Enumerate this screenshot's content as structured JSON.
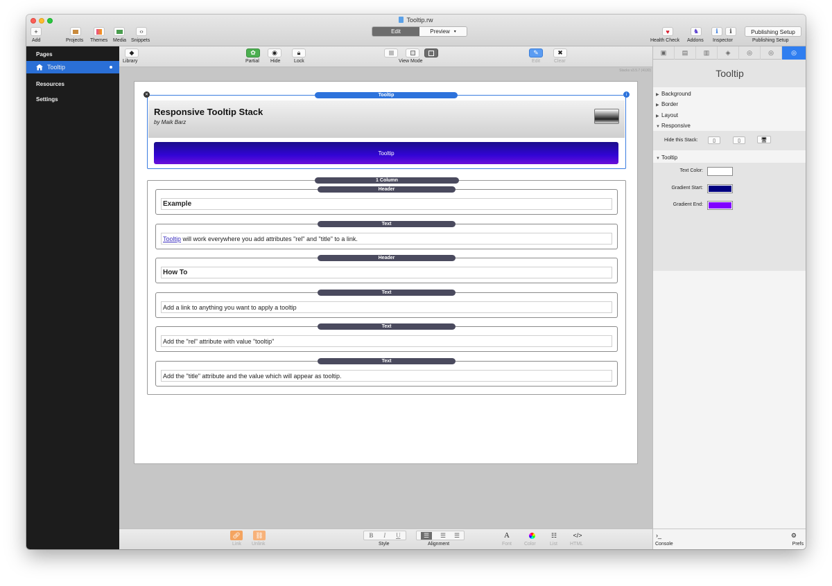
{
  "window": {
    "title": "Tooltip.rw"
  },
  "toolbar": {
    "add": "Add",
    "projects": "Projects",
    "themes": "Themes",
    "media": "Media",
    "snippets": "Snippets",
    "edit": "Edit",
    "preview": "Preview",
    "health_check": "Health Check",
    "addons": "Addons",
    "inspector": "Inspector",
    "publishing_setup_button": "Publishing Setup",
    "publishing_setup_label": "Publishing Setup"
  },
  "sidebar": {
    "pages_header": "Pages",
    "selected_page": "Tooltip",
    "resources": "Resources",
    "settings": "Settings"
  },
  "toolbar2": {
    "library": "Library",
    "partial": "Partial",
    "hide": "Hide",
    "lock": "Lock",
    "view_mode": "View Mode",
    "edit": "Edit",
    "clear": "Clear"
  },
  "canvas": {
    "version": "Stacks v3.5.7 (4130)",
    "tooltip_stack": {
      "tag": "Tooltip",
      "title": "Responsive Tooltip Stack",
      "author": "by Maik Barz",
      "button": "Tooltip"
    },
    "column_stack": {
      "tag": "1 Column",
      "items": [
        {
          "tag": "Header",
          "text": "Example"
        },
        {
          "tag": "Text",
          "link": "Tooltip",
          "text": " will work everywhere you add attributes \"rel\" and \"title\" to a link."
        },
        {
          "tag": "Header",
          "text": "How To"
        },
        {
          "tag": "Text",
          "text": "Add a link to anything you want to apply a tooltip"
        },
        {
          "tag": "Text",
          "text": "Add the \"rel\" attribute with value \"tooltip\""
        },
        {
          "tag": "Text",
          "text": "Add the \"title\" attribute and the value which will appear as tooltip."
        }
      ]
    }
  },
  "bottombar": {
    "link": "Link",
    "unlink": "Unlink",
    "style": "Style",
    "alignment": "Alignment",
    "font": "Font",
    "color": "Color",
    "list": "List",
    "html": "HTML"
  },
  "inspector": {
    "title": "Tooltip",
    "sections": {
      "background": "Background",
      "border": "Border",
      "layout": "Layout",
      "responsive": "Responsive",
      "hide_this_stack": "Hide this Stack:",
      "tooltip": "Tooltip",
      "text_color": "Text Color:",
      "gradient_start": "Gradient Start:",
      "gradient_end": "Gradient End:"
    },
    "colors": {
      "text_color": "#ffffff",
      "gradient_start": "#000080",
      "gradient_end": "#8000ff"
    },
    "console": "Console",
    "prefs": "Prefs"
  }
}
